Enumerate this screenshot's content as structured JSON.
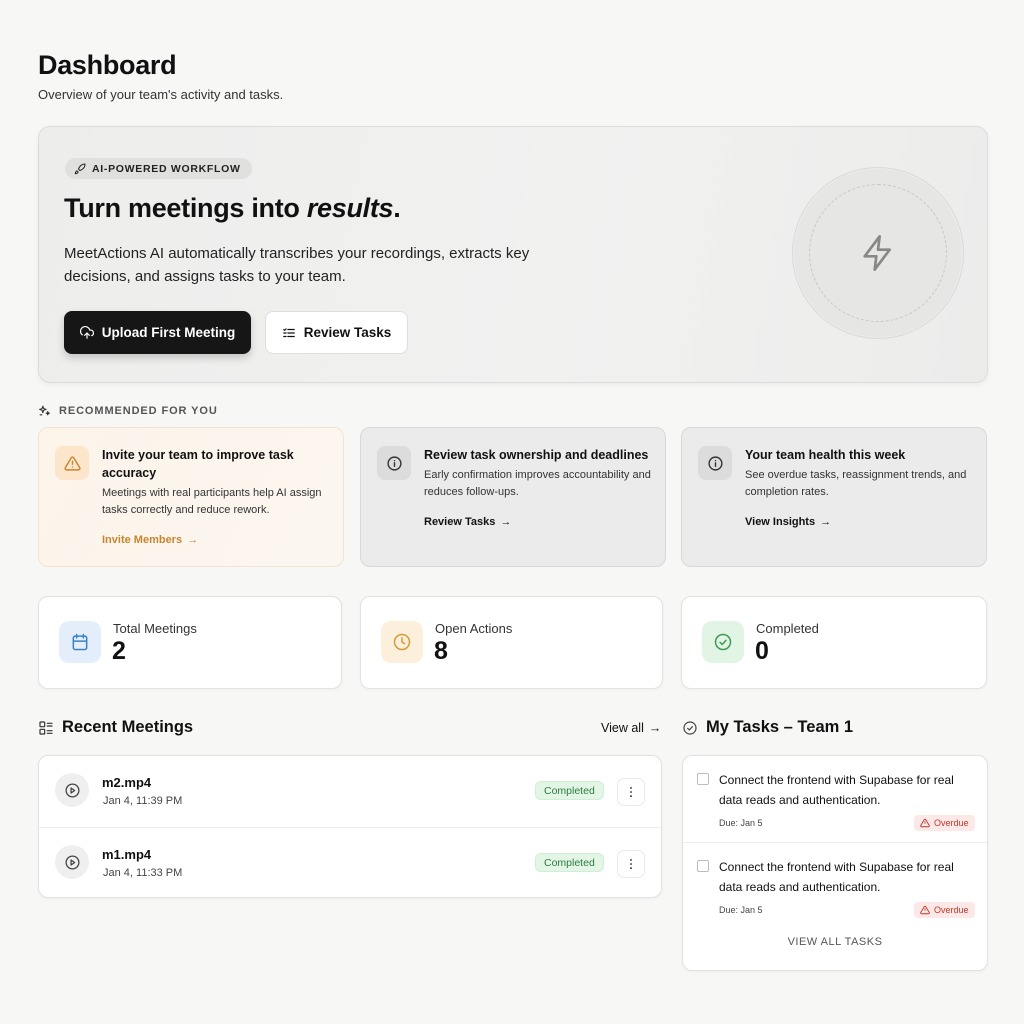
{
  "header": {
    "title": "Dashboard",
    "subtitle": "Overview of your team's activity and tasks."
  },
  "hero": {
    "pill": "AI-POWERED WORKFLOW",
    "heading_main": "Turn meetings into ",
    "heading_emphasis": "results",
    "heading_end": ".",
    "description": "MeetActions AI automatically transcribes your recordings, extracts key decisions, and assigns tasks to your team.",
    "primary_button": "Upload First Meeting",
    "secondary_button": "Review Tasks",
    "feature_icon": "lightning-icon"
  },
  "recommended": {
    "label": "RECOMMENDED FOR YOU",
    "cards": [
      {
        "title": "Invite your team to improve task accuracy",
        "description": "Meetings with real participants help AI assign tasks correctly and reduce rework.",
        "link": "Invite Members",
        "icon": "warning-icon",
        "accent": "#c8852e"
      },
      {
        "title": "Review task ownership and deadlines",
        "description": "Early confirmation improves accountability and reduces follow-ups.",
        "link": "Review Tasks",
        "icon": "info-icon"
      },
      {
        "title": "Your team health this week",
        "description": "See overdue tasks, reassignment trends, and completion rates.",
        "link": "View Insights",
        "icon": "info-icon"
      }
    ]
  },
  "stats": [
    {
      "label": "Total Meetings",
      "value": "2",
      "icon": "calendar-icon",
      "color": "#3b82c4"
    },
    {
      "label": "Open Actions",
      "value": "8",
      "icon": "clock-icon",
      "color": "#d69a3a"
    },
    {
      "label": "Completed",
      "value": "0",
      "icon": "check-circle-icon",
      "color": "#3f9a55"
    }
  ],
  "recent_meetings": {
    "title": "Recent Meetings",
    "view_all": "View all",
    "items": [
      {
        "name": "m2.mp4",
        "date": "Jan 4, 11:39 PM",
        "status": "Completed"
      },
      {
        "name": "m1.mp4",
        "date": "Jan 4, 11:33 PM",
        "status": "Completed"
      }
    ]
  },
  "my_tasks": {
    "title": "My Tasks – Team 1",
    "items": [
      {
        "text": "Connect the frontend with Supabase for real data reads and authentication.",
        "due": "Due: Jan 5",
        "status": "Overdue"
      },
      {
        "text": "Connect the frontend with Supabase for real data reads and authentication.",
        "due": "Due: Jan 5",
        "status": "Overdue"
      }
    ],
    "view_all": "VIEW ALL TASKS"
  },
  "colors": {
    "primary_dark": "#161616",
    "success": "#2d7a3e",
    "danger": "#c0392b",
    "warm_accent": "#c8852e"
  }
}
